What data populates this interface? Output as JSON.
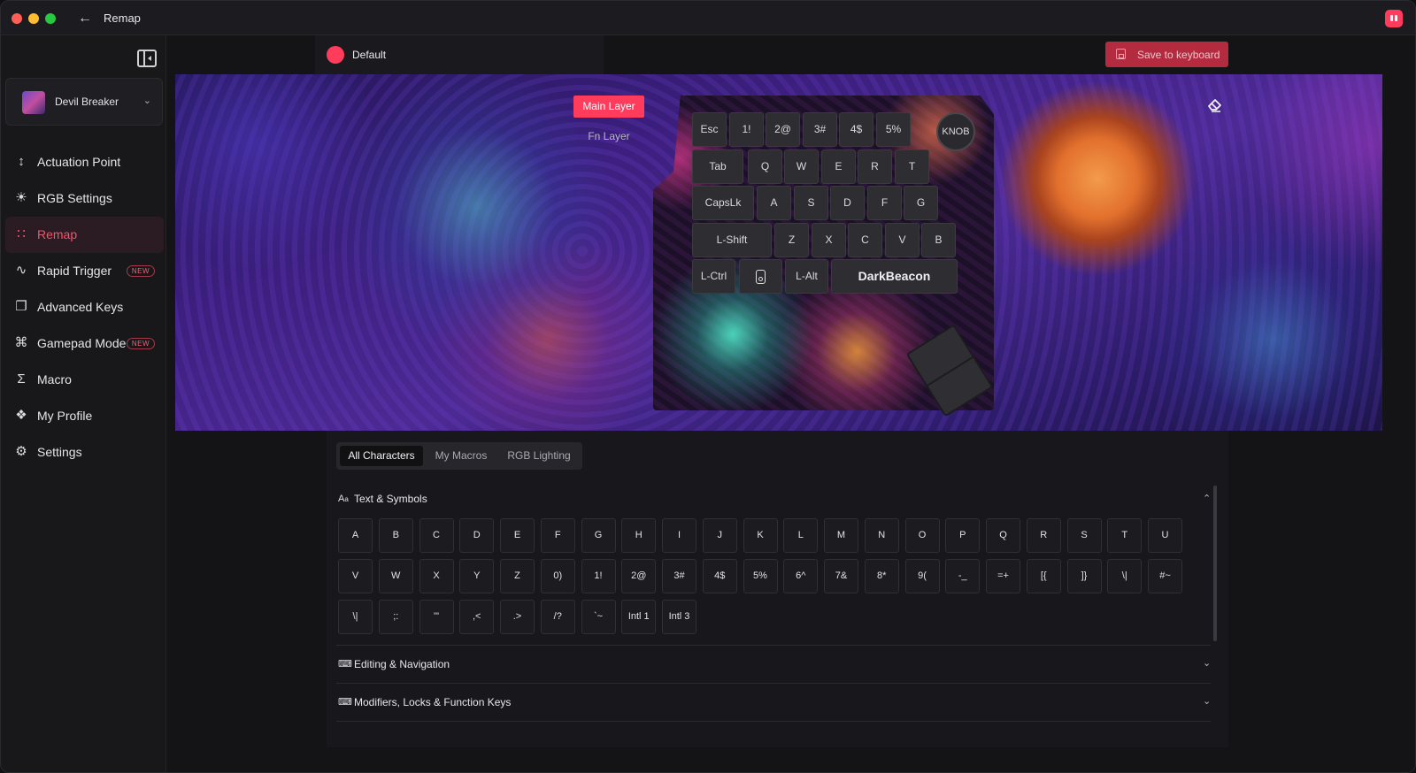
{
  "window": {
    "title": "Remap"
  },
  "sidebar": {
    "device_name": "Devil Breaker",
    "items": [
      {
        "label": "Actuation Point",
        "icon": "actuation-icon",
        "badge": ""
      },
      {
        "label": "RGB Settings",
        "icon": "sun-icon",
        "badge": ""
      },
      {
        "label": "Remap",
        "icon": "grid-icon",
        "badge": "",
        "active": true
      },
      {
        "label": "Rapid Trigger",
        "icon": "pulse-icon",
        "badge": "NEW"
      },
      {
        "label": "Advanced Keys",
        "icon": "advanced-keys-icon",
        "badge": ""
      },
      {
        "label": "Gamepad Mode",
        "icon": "gamepad-icon",
        "badge": "NEW"
      },
      {
        "label": "Macro",
        "icon": "sigma-icon",
        "badge": ""
      },
      {
        "label": "My Profile",
        "icon": "profile-grid-icon",
        "badge": ""
      },
      {
        "label": "Settings",
        "icon": "gear-icon",
        "badge": ""
      }
    ]
  },
  "profile": {
    "name": "Default"
  },
  "toolbar": {
    "save_label": "Save to keyboard"
  },
  "layers": {
    "main": "Main Layer",
    "fn": "Fn Layer"
  },
  "keyboard": {
    "knob_label": "KNOB",
    "rows": [
      [
        "Esc",
        "1!",
        "2@",
        "3#",
        "4$",
        "5%"
      ],
      [
        "Tab",
        "Q",
        "W",
        "E",
        "R",
        "T"
      ],
      [
        "CapsLk",
        "A",
        "S",
        "D",
        "F",
        "G"
      ],
      [
        "L-Shift",
        "Z",
        "X",
        "C",
        "V",
        "B"
      ],
      [
        "L-Ctrl",
        "",
        "L-Alt",
        "DarkBeacon"
      ]
    ]
  },
  "picker": {
    "tabs": [
      "All Characters",
      "My Macros",
      "RGB Lighting"
    ],
    "sections": [
      {
        "title": "Text & Symbols",
        "icon": "text-symbols-icon",
        "expanded": true
      },
      {
        "title": "Editing & Navigation",
        "icon": "keyboard-icon",
        "expanded": false
      },
      {
        "title": "Modifiers, Locks & Function Keys",
        "icon": "keyboard-icon",
        "expanded": false
      }
    ],
    "chars": [
      [
        "A",
        "B",
        "C",
        "D",
        "E",
        "F",
        "G",
        "H",
        "I",
        "J",
        "K",
        "L",
        "M",
        "N",
        "O",
        "P",
        "Q",
        "R",
        "S",
        "T",
        "U"
      ],
      [
        "V",
        "W",
        "X",
        "Y",
        "Z",
        "0)",
        "1!",
        "2@",
        "3#",
        "4$",
        "5%",
        "6^",
        "7&",
        "8*",
        "9(",
        "-_",
        "=+",
        "[{",
        "]}",
        "\\|",
        "#~"
      ],
      [
        "\\|",
        ";:",
        "'\"",
        ",<",
        ".>",
        "/?",
        "`~",
        "Intl 1",
        "Intl 3"
      ]
    ]
  },
  "colors": {
    "accent": "#ff3c5c",
    "save_button": "#b42a3e"
  }
}
